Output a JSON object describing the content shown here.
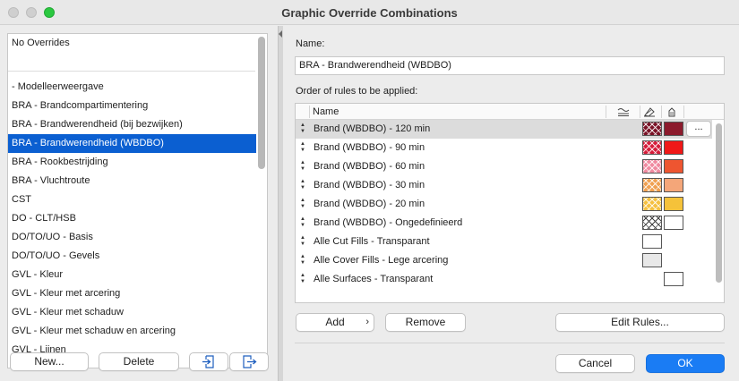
{
  "window": {
    "title": "Graphic Override Combinations"
  },
  "left_panel": {
    "top_item": "No Overrides",
    "items": [
      "- Modelleerweergave",
      "BRA - Brandcompartimentering",
      "BRA - Brandwerendheid (bij bezwijken)",
      "BRA - Brandwerendheid (WBDBO)",
      "BRA - Rookbestrijding",
      "BRA - Vluchtroute",
      "CST",
      "DO - CLT/HSB",
      "DO/TO/UO - Basis",
      "DO/TO/UO - Gevels",
      "GVL - Kleur",
      "GVL - Kleur met arcering",
      "GVL - Kleur met schaduw",
      "GVL - Kleur met schaduw en arcering",
      "GVL - Lijnen"
    ],
    "selected_index": 3,
    "buttons": {
      "new": "New...",
      "delete": "Delete"
    }
  },
  "right_panel": {
    "name_label": "Name:",
    "name_value": "BRA - Brandwerendheid (WBDBO)",
    "rules_label": "Order of rules to be applied:",
    "table_header": {
      "name": "Name"
    },
    "rules": [
      {
        "name": "Brand (WBDBO) - 120 min",
        "fill_color": "#7a1226",
        "surface_color": "#8c1a2c",
        "selected": true
      },
      {
        "name": "Brand (WBDBO) -  90 min",
        "fill_color": "#d61c3a",
        "surface_color": "#f01818"
      },
      {
        "name": "Brand (WBDBO) -  60 min",
        "fill_color": "#f08aa0",
        "surface_color": "#ee5530"
      },
      {
        "name": "Brand (WBDBO) -  30 min",
        "fill_color": "#f0a050",
        "surface_color": "#f4a679"
      },
      {
        "name": "Brand (WBDBO) -  20 min",
        "fill_color": "#f5c040",
        "surface_color": "#f5c23a"
      },
      {
        "name": "Brand (WBDBO) - Ongedefinieerd",
        "fill_color": "#ffffff",
        "surface_color": "#ffffff"
      },
      {
        "name": "Alle Cut Fills - Transparant",
        "fill_color": "#ffffff"
      },
      {
        "name": "Alle Cover Fills - Lege arcering",
        "fill_color": "#e8e8e8"
      },
      {
        "name": "Alle Surfaces - Transparant",
        "surface_color": "#ffffff"
      }
    ],
    "more_button": "...",
    "buttons": {
      "add": "Add",
      "remove": "Remove",
      "edit_rules": "Edit Rules..."
    },
    "cancel": "Cancel",
    "ok": "OK"
  },
  "icons": {
    "table_col_1": "line-overrides-icon",
    "table_col_2": "fill-overrides-icon",
    "table_col_3": "surface-overrides-icon",
    "list_import": "import-icon",
    "list_export": "export-icon"
  },
  "colors": {
    "selection": "#0b5fd1",
    "primary_button": "#1a7cf4"
  }
}
